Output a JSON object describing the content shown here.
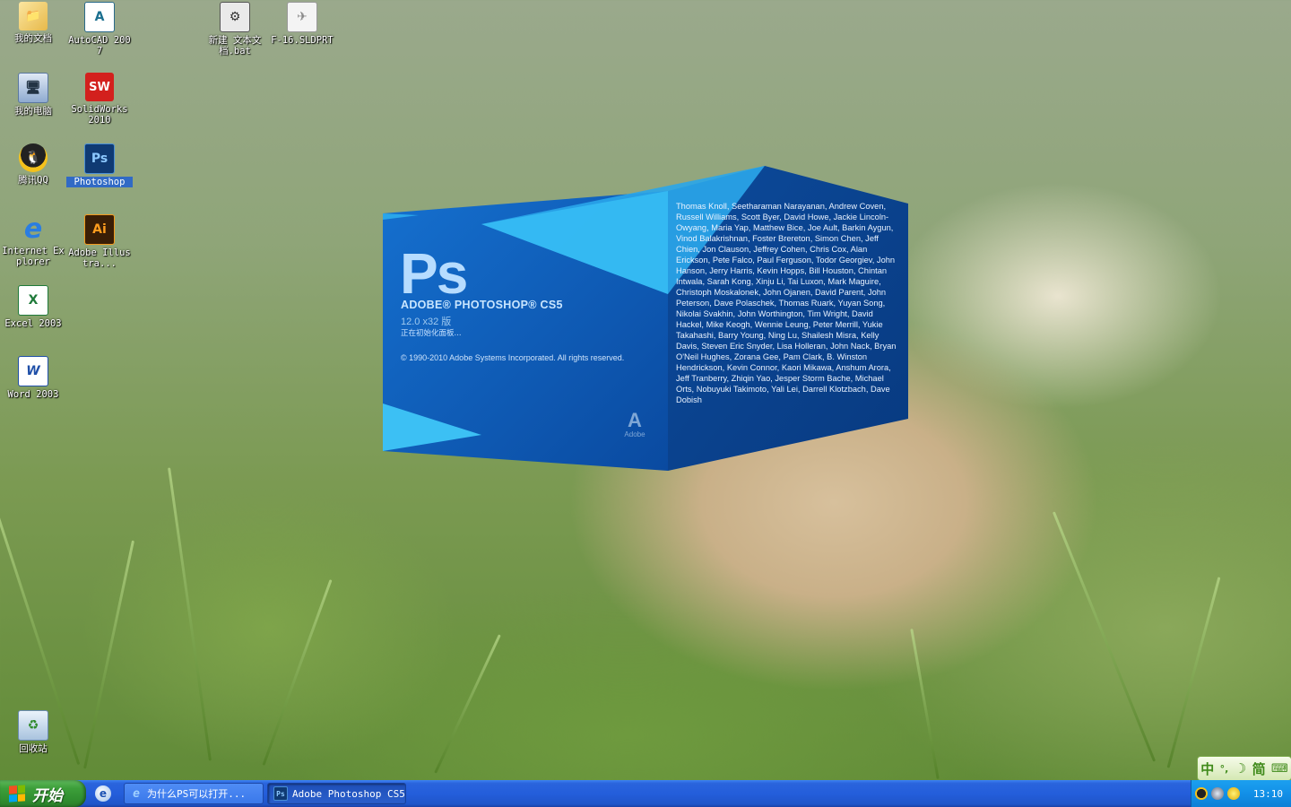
{
  "desktop_icons": [
    {
      "label": "我的文档",
      "icon": "my-documents-icon"
    },
    {
      "label": "AutoCAD 2007",
      "icon": "autocad-icon"
    },
    {
      "label": "新建 文本文档.bat",
      "icon": "batch-file-icon"
    },
    {
      "label": "F-16.SLDPRT",
      "icon": "sldprt-file-icon"
    },
    {
      "label": "我的电脑",
      "icon": "my-computer-icon"
    },
    {
      "label": "SolidWorks 2010",
      "icon": "solidworks-icon"
    },
    {
      "label": "腾讯QQ",
      "icon": "qq-icon"
    },
    {
      "label": "Photoshop",
      "icon": "photoshop-icon"
    },
    {
      "label": "Internet Explorer",
      "icon": "internet-explorer-icon"
    },
    {
      "label": "Adobe Illustra...",
      "icon": "illustrator-icon"
    },
    {
      "label": "Excel 2003",
      "icon": "excel-icon"
    },
    {
      "label": "Word 2003",
      "icon": "word-icon"
    },
    {
      "label": "回收站",
      "icon": "recycle-bin-icon"
    }
  ],
  "icon_glyphs": {
    "autocad": "A",
    "solidworks": "SW",
    "photoshop": "Ps",
    "illustrator": "Ai",
    "excel": "X",
    "word": "W",
    "ie": "e"
  },
  "splash": {
    "logo": "Ps",
    "product": "ADOBE® PHOTOSHOP® CS5",
    "version": "12.0 x32 版",
    "status": "正在初始化面板...",
    "copyright": "© 1990-2010 Adobe Systems Incorporated. All rights reserved.",
    "credits": "Thomas Knoll, Seetharaman Narayanan, Andrew Coven, Russell Williams, Scott Byer, David Howe, Jackie Lincoln-Owyang, Maria Yap, Matthew Bice, Joe Ault, Barkin Aygun, Vinod Balakrishnan, Foster Brereton, Simon Chen, Jeff Chien, Jon Clauson, Jeffrey Cohen, Chris Cox, Alan Erickson, Pete Falco, Paul Ferguson, Todor Georgiev, John Hanson, Jerry Harris, Kevin Hopps, Bill Houston, Chintan Intwala, Sarah Kong, Xinju Li, Tai Luxon, Mark Maguire, Christoph Moskalonek, John Ojanen, David Parent, John Peterson, Dave Polaschek, Thomas Ruark, Yuyan Song, Nikolai Svakhin, John Worthington, Tim Wright, David Hackel, Mike Keogh, Wennie Leung, Peter Merrill, Yukie Takahashi, Barry Young, Ning Lu, Shailesh Misra, Kelly Davis, Steven Eric Snyder, Lisa Holleran, John Nack, Bryan O'Neil Hughes, Zorana Gee, Pam Clark, B. Winston Hendrickson, Kevin Connor, Kaori Mikawa, Anshum Arora, Jeff Tranberry, Zhiqin Yao, Jesper Storm Bache, Michael Orts, Nobuyuki Takimoto, Yali Lei, Darrell Klotzbach, Dave Dobish",
    "adobe_logo": "A",
    "adobe_text": "Adobe"
  },
  "ime_bar": {
    "mode": "中",
    "punct": "°,",
    "moon": "☽",
    "simplified": "简",
    "keyboard": "⌨"
  },
  "taskbar": {
    "start_label": "开始",
    "quick_launch_glyph": "e",
    "tasks": [
      {
        "label": "为什么PS可以打开...",
        "icon": "ie-icon",
        "glyph": "e"
      },
      {
        "label": "Adobe Photoshop CS5",
        "icon": "photoshop-icon",
        "glyph": "Ps"
      }
    ],
    "clock": "13:10"
  },
  "colors": {
    "taskbar_blue": "#245edb",
    "start_green": "#3d9f3a",
    "tray_blue": "#1290e8",
    "splash_blue": "#0a4fa6",
    "splash_light": "#2fb2f0"
  }
}
